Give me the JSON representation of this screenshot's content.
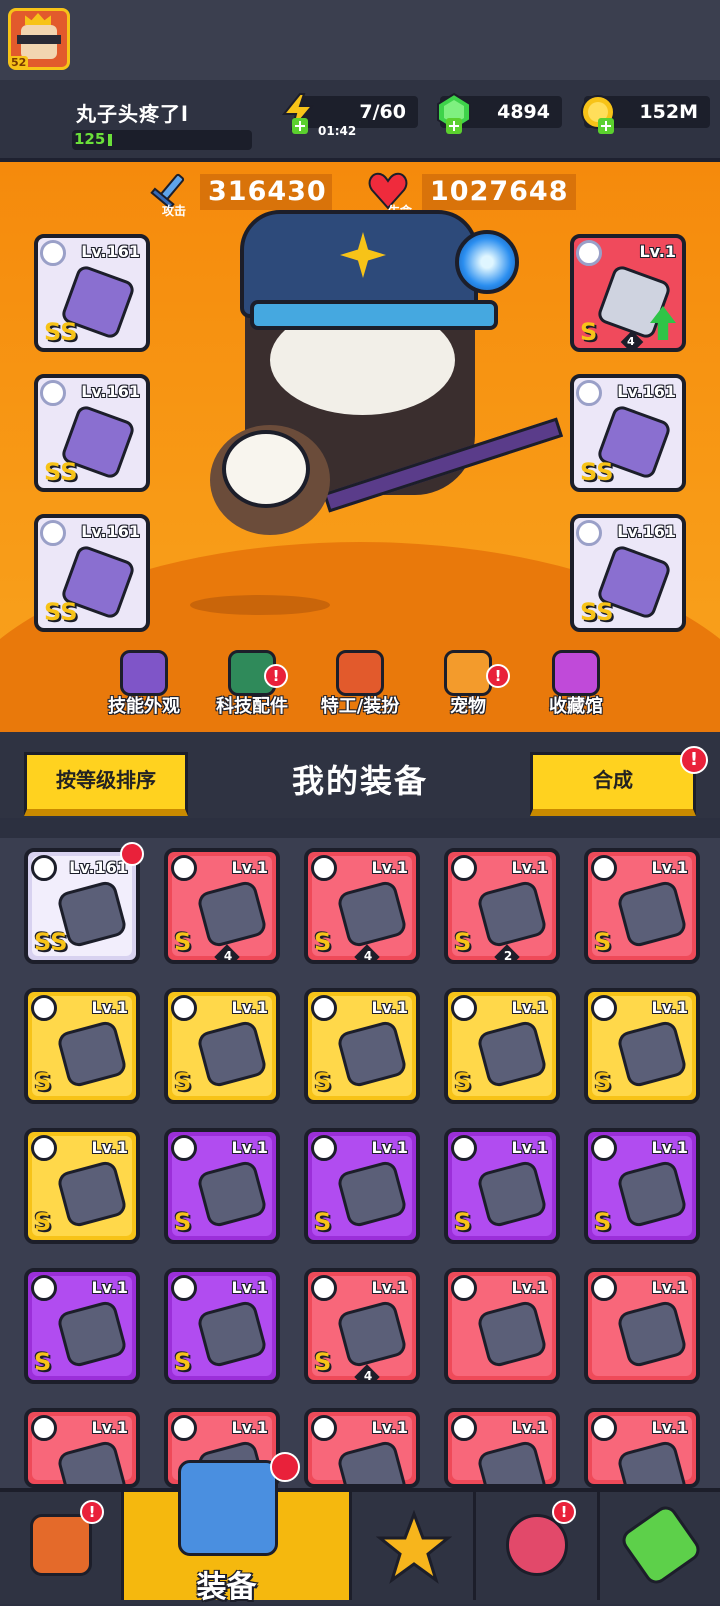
{
  "player": {
    "name": "丸子头疼了l",
    "level": "52",
    "xp": "125"
  },
  "resources": {
    "energy": {
      "value": "7/60",
      "timer": "01:42"
    },
    "gems": {
      "value": "4894"
    },
    "coins": {
      "value": "152M"
    }
  },
  "stats": {
    "attack": {
      "label": "攻击",
      "value": "316430"
    },
    "hp": {
      "label": "生命",
      "value": "1027648"
    }
  },
  "equipped_slots": {
    "left": [
      {
        "level": "Lv.161",
        "grade": "SS",
        "type": "weapon"
      },
      {
        "level": "Lv.161",
        "grade": "SS",
        "type": "necklace"
      },
      {
        "level": "Lv.161",
        "grade": "SS",
        "type": "gloves"
      }
    ],
    "right": [
      {
        "level": "Lv.1",
        "grade": "S",
        "type": "armor",
        "stack": "4",
        "upgrade_available": true
      },
      {
        "level": "Lv.161",
        "grade": "SS",
        "type": "belt"
      },
      {
        "level": "Lv.161",
        "grade": "SS",
        "type": "boots"
      }
    ]
  },
  "menu": [
    {
      "label": "技能外观",
      "badge": false,
      "icon": "skill-skin-icon",
      "color": "#7f55c8"
    },
    {
      "label": "科技配件",
      "badge": true,
      "icon": "tech-part-icon",
      "color": "#2f8a5a"
    },
    {
      "label": "特工/装扮",
      "badge": false,
      "icon": "agent-costume-icon",
      "color": "#e25a2c"
    },
    {
      "label": "宠物",
      "badge": true,
      "icon": "pet-icon",
      "color": "#f39b2c"
    },
    {
      "label": "收藏馆",
      "badge": false,
      "icon": "collection-icon",
      "color": "#c04ad9"
    }
  ],
  "equipment_header": {
    "sort_button": "按等级排序",
    "title": "我的装备",
    "merge_button": "合成",
    "merge_badge": "!"
  },
  "inventory": [
    {
      "level": "Lv.161",
      "grade": "SS",
      "rarity": "lav",
      "type": "armor",
      "stack": "",
      "new": true
    },
    {
      "level": "Lv.1",
      "grade": "S",
      "rarity": "red",
      "type": "belt",
      "stack": "4",
      "new": false
    },
    {
      "level": "Lv.1",
      "grade": "S",
      "rarity": "red",
      "type": "boots",
      "stack": "4",
      "new": false
    },
    {
      "level": "Lv.1",
      "grade": "S",
      "rarity": "red",
      "type": "gloves",
      "stack": "2",
      "new": false
    },
    {
      "level": "Lv.1",
      "grade": "S",
      "rarity": "red",
      "type": "armor",
      "stack": "",
      "new": false
    },
    {
      "level": "Lv.1",
      "grade": "S",
      "rarity": "yellow",
      "type": "weapon",
      "stack": "",
      "new": false
    },
    {
      "level": "Lv.1",
      "grade": "S",
      "rarity": "yellow",
      "type": "necklace",
      "stack": "",
      "new": false
    },
    {
      "level": "Lv.1",
      "grade": "S",
      "rarity": "yellow",
      "type": "gloves",
      "stack": "",
      "new": false
    },
    {
      "level": "Lv.1",
      "grade": "S",
      "rarity": "yellow",
      "type": "boots",
      "stack": "",
      "new": false
    },
    {
      "level": "Lv.1",
      "grade": "S",
      "rarity": "yellow",
      "type": "boots",
      "stack": "",
      "new": false
    },
    {
      "level": "Lv.1",
      "grade": "S",
      "rarity": "yellow",
      "type": "boots",
      "stack": "",
      "new": false
    },
    {
      "level": "Lv.1",
      "grade": "S",
      "rarity": "purple",
      "type": "weapon",
      "stack": "",
      "new": false
    },
    {
      "level": "Lv.1",
      "grade": "S",
      "rarity": "purple",
      "type": "armor",
      "stack": "",
      "new": false
    },
    {
      "level": "Lv.1",
      "grade": "S",
      "rarity": "purple",
      "type": "necklace",
      "stack": "",
      "new": false
    },
    {
      "level": "Lv.1",
      "grade": "S",
      "rarity": "purple",
      "type": "belt",
      "stack": "",
      "new": false
    },
    {
      "level": "Lv.1",
      "grade": "S",
      "rarity": "purple",
      "type": "gloves",
      "stack": "",
      "new": false
    },
    {
      "level": "Lv.1",
      "grade": "S",
      "rarity": "purple",
      "type": "boots",
      "stack": "",
      "new": false
    },
    {
      "level": "Lv.1",
      "grade": "S",
      "rarity": "red",
      "type": "gloves",
      "stack": "4",
      "new": false
    },
    {
      "level": "Lv.1",
      "grade": "",
      "rarity": "red",
      "type": "weapon",
      "stack": "",
      "new": false
    },
    {
      "level": "Lv.1",
      "grade": "",
      "rarity": "red",
      "type": "weapon",
      "stack": "",
      "new": false
    },
    {
      "level": "Lv.1",
      "grade": "",
      "rarity": "red",
      "type": "weapon",
      "stack": "",
      "new": false
    },
    {
      "level": "Lv.1",
      "grade": "",
      "rarity": "red",
      "type": "weapon",
      "stack": "",
      "new": false
    },
    {
      "level": "Lv.1",
      "grade": "",
      "rarity": "red",
      "type": "weapon",
      "stack": "",
      "new": false
    },
    {
      "level": "Lv.1",
      "grade": "",
      "rarity": "red",
      "type": "armor",
      "stack": "",
      "new": false
    },
    {
      "level": "Lv.1",
      "grade": "",
      "rarity": "red",
      "type": "armor",
      "stack": "",
      "new": false
    }
  ],
  "nav": [
    {
      "label": "",
      "icon": "shop-icon",
      "badge": true,
      "active": false
    },
    {
      "label": "装备",
      "icon": "equipment-icon",
      "badge": true,
      "active": true
    },
    {
      "label": "",
      "icon": "battle-star-icon",
      "badge": false,
      "active": false
    },
    {
      "label": "",
      "icon": "planet-icon",
      "badge": true,
      "active": false
    },
    {
      "label": "",
      "icon": "dna-tube-icon",
      "badge": false,
      "active": false
    }
  ],
  "colors": {
    "hero_bg": "#f58a0c",
    "accent_yellow": "#ffd21f",
    "badge_red": "#e9213a",
    "panel_dark": "#2f3342"
  }
}
